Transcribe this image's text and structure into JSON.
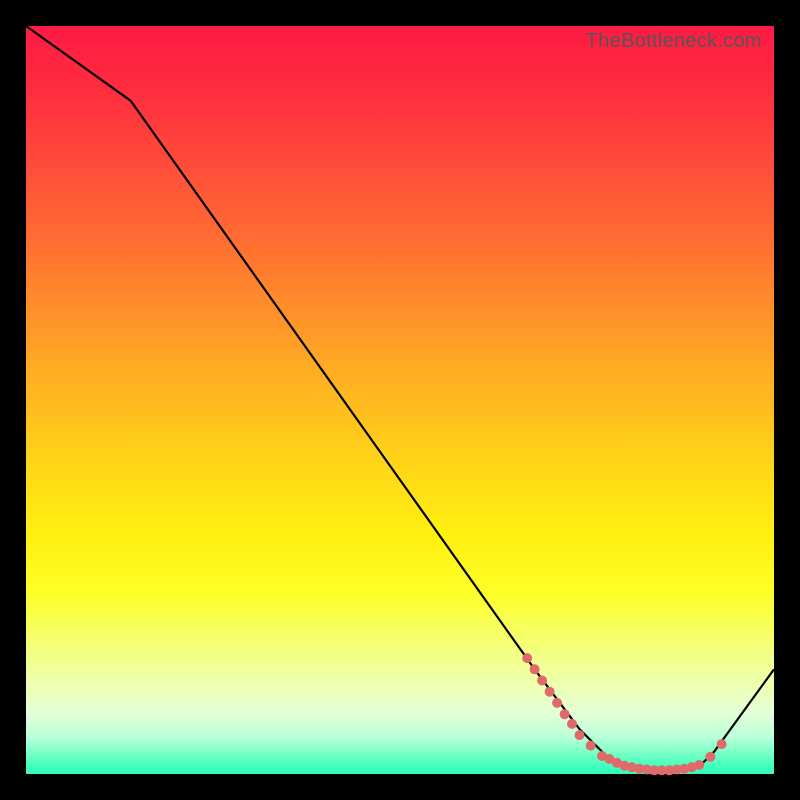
{
  "watermark": "TheBottleneck.com",
  "chart_data": {
    "type": "line",
    "title": "",
    "xlabel": "",
    "ylabel": "",
    "xlim": [
      0,
      100
    ],
    "ylim": [
      0,
      100
    ],
    "series": [
      {
        "name": "bottleneck-curve",
        "x": [
          0,
          14,
          68,
          74,
          78,
          82,
          86,
          90,
          92,
          100
        ],
        "y": [
          100,
          90,
          14,
          6,
          2,
          0.5,
          0.5,
          1,
          3,
          14
        ]
      }
    ],
    "markers": {
      "name": "highlight-points",
      "color": "#e06a6a",
      "points_xy": [
        [
          67,
          15.5
        ],
        [
          68,
          14
        ],
        [
          69,
          12.5
        ],
        [
          70,
          11
        ],
        [
          71,
          9.5
        ],
        [
          72,
          8
        ],
        [
          73,
          6.7
        ],
        [
          74,
          5.2
        ],
        [
          75.5,
          3.8
        ],
        [
          77,
          2.4
        ],
        [
          78,
          2.0
        ],
        [
          79,
          1.5
        ],
        [
          80,
          1.1
        ],
        [
          81,
          0.9
        ],
        [
          82,
          0.7
        ],
        [
          83,
          0.6
        ],
        [
          84,
          0.5
        ],
        [
          85,
          0.5
        ],
        [
          86,
          0.5
        ],
        [
          87,
          0.6
        ],
        [
          88,
          0.7
        ],
        [
          89,
          0.9
        ],
        [
          90,
          1.2
        ],
        [
          91.5,
          2.3
        ],
        [
          93,
          4.0
        ]
      ]
    },
    "background_gradient": {
      "top": "#ff1a44",
      "mid": "#fff010",
      "bottom": "#2effb8"
    }
  }
}
